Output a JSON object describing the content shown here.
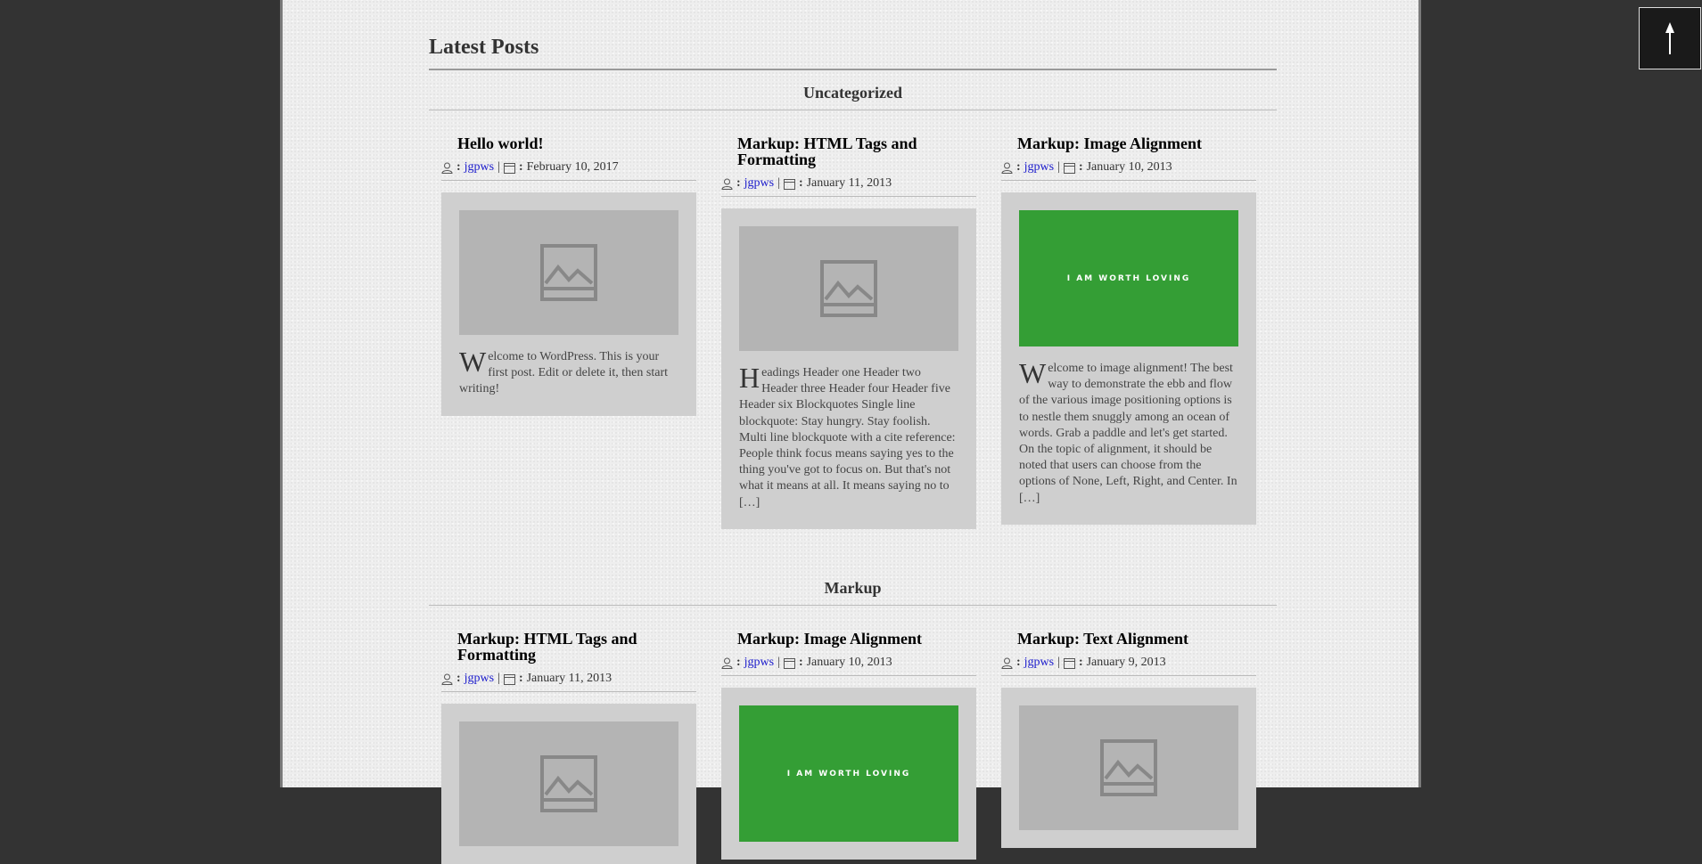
{
  "heading": "Latest Posts",
  "categories": [
    {
      "name": "Uncategorized",
      "posts": [
        {
          "title": "Hello world!",
          "author": "jgpws",
          "date": "February 10, 2017",
          "image": "placeholder",
          "dropcap": "W",
          "excerpt": "elcome to WordPress. This is your first post. Edit or delete it, then start writing!"
        },
        {
          "title": "Markup: HTML Tags and Formatting",
          "author": "jgpws",
          "date": "January 11, 2013",
          "image": "placeholder",
          "dropcap": "H",
          "excerpt": "eadings Header one Header two Header three Header four Header five Header six Blockquotes Single line blockquote: Stay hungry. Stay foolish. Multi line blockquote with a cite reference: People think focus means saying yes to the thing you've got to focus on. But that's not what it means at all. It means saying no to […]"
        },
        {
          "title": "Markup: Image Alignment",
          "author": "jgpws",
          "date": "January 10, 2013",
          "image": "green",
          "image_text": "I AM WORTH LOVING",
          "dropcap": "W",
          "excerpt": "elcome to image alignment! The best way to demonstrate the ebb and flow of the various image positioning options is to nestle them snuggly among an ocean of words. Grab a paddle and let's get started. On the topic of alignment, it should be noted that users can choose from the options of None, Left, Right, and Center. In […]"
        }
      ]
    },
    {
      "name": "Markup",
      "posts": [
        {
          "title": "Markup: HTML Tags and Formatting",
          "author": "jgpws",
          "date": "January 11, 2013",
          "image": "placeholder"
        },
        {
          "title": "Markup: Image Alignment",
          "author": "jgpws",
          "date": "January 10, 2013",
          "image": "green",
          "image_text": "I AM WORTH LOVING"
        },
        {
          "title": "Markup: Text Alignment",
          "author": "jgpws",
          "date": "January 9, 2013",
          "image": "placeholder"
        }
      ]
    }
  ],
  "meta_separator": "|",
  "colors": {
    "background": "#333333",
    "page": "#eeeeee",
    "card": "#cfcfcf",
    "placeholder": "#b4b4b4",
    "green": "#349e35",
    "link": "#1a1acc"
  },
  "scroll_top_icon": "arrow-up-icon"
}
